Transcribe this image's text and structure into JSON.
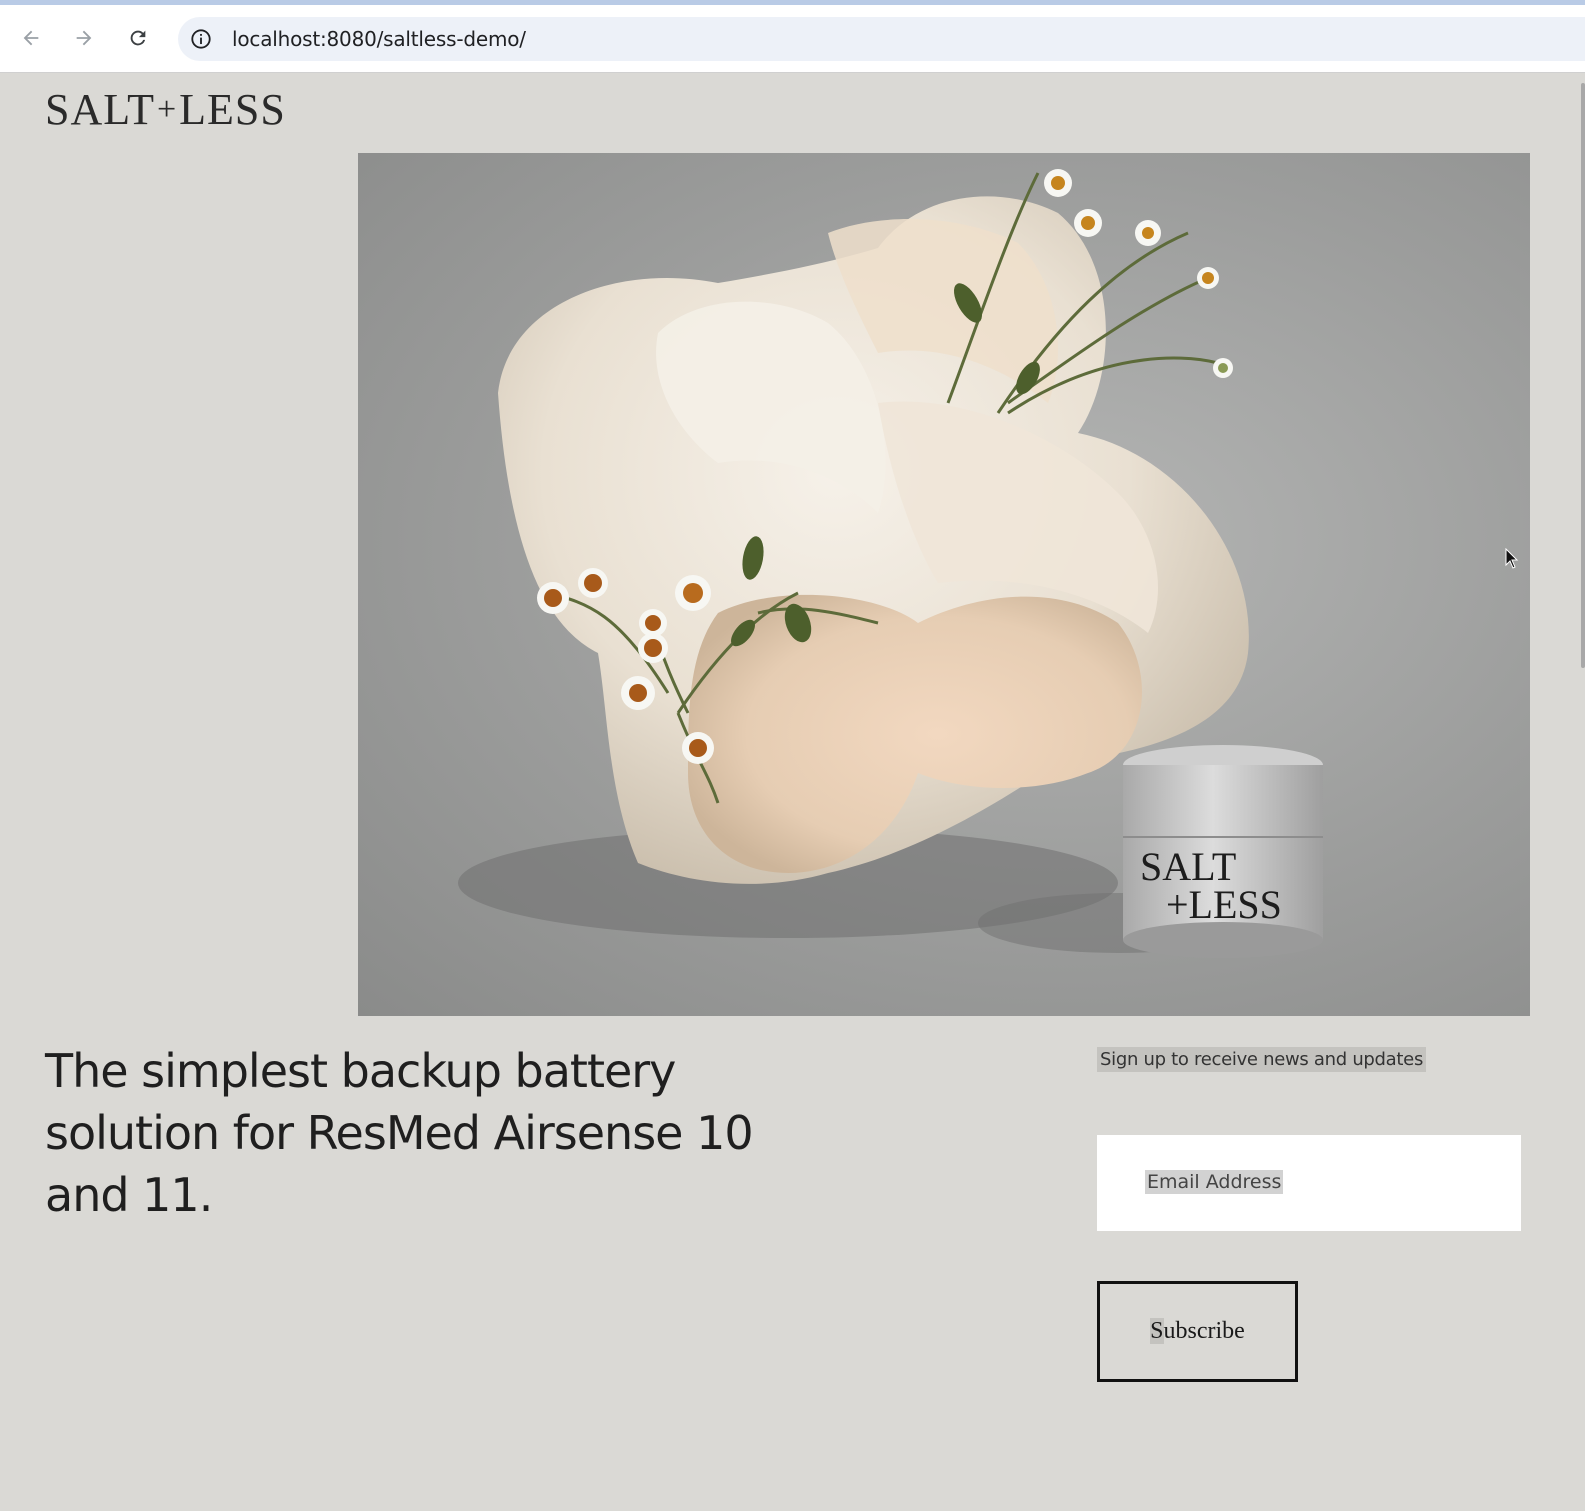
{
  "browser": {
    "url": "localhost:8080/saltless-demo/",
    "back_icon": "arrow-left-icon",
    "forward_icon": "arrow-right-icon",
    "reload_icon": "reload-icon",
    "info_icon": "info-icon"
  },
  "header": {
    "logo_left": "SALT",
    "logo_plus": "+",
    "logo_right": "LESS"
  },
  "hero": {
    "image_description_icon": "product-photo",
    "jar_label_line1": "SALT",
    "jar_label_line2": "+LESS"
  },
  "main": {
    "headline": "The simplest backup battery solution for ResMed Airsense 10 and 11."
  },
  "signup": {
    "label": "Sign up to receive news and updates",
    "email_placeholder": "Email Address",
    "subscribe_first": "S",
    "subscribe_rest": "ubscribe"
  },
  "colors": {
    "page_bg": "#dad9d5",
    "text": "#1f1f1f",
    "button_border": "#111111"
  }
}
